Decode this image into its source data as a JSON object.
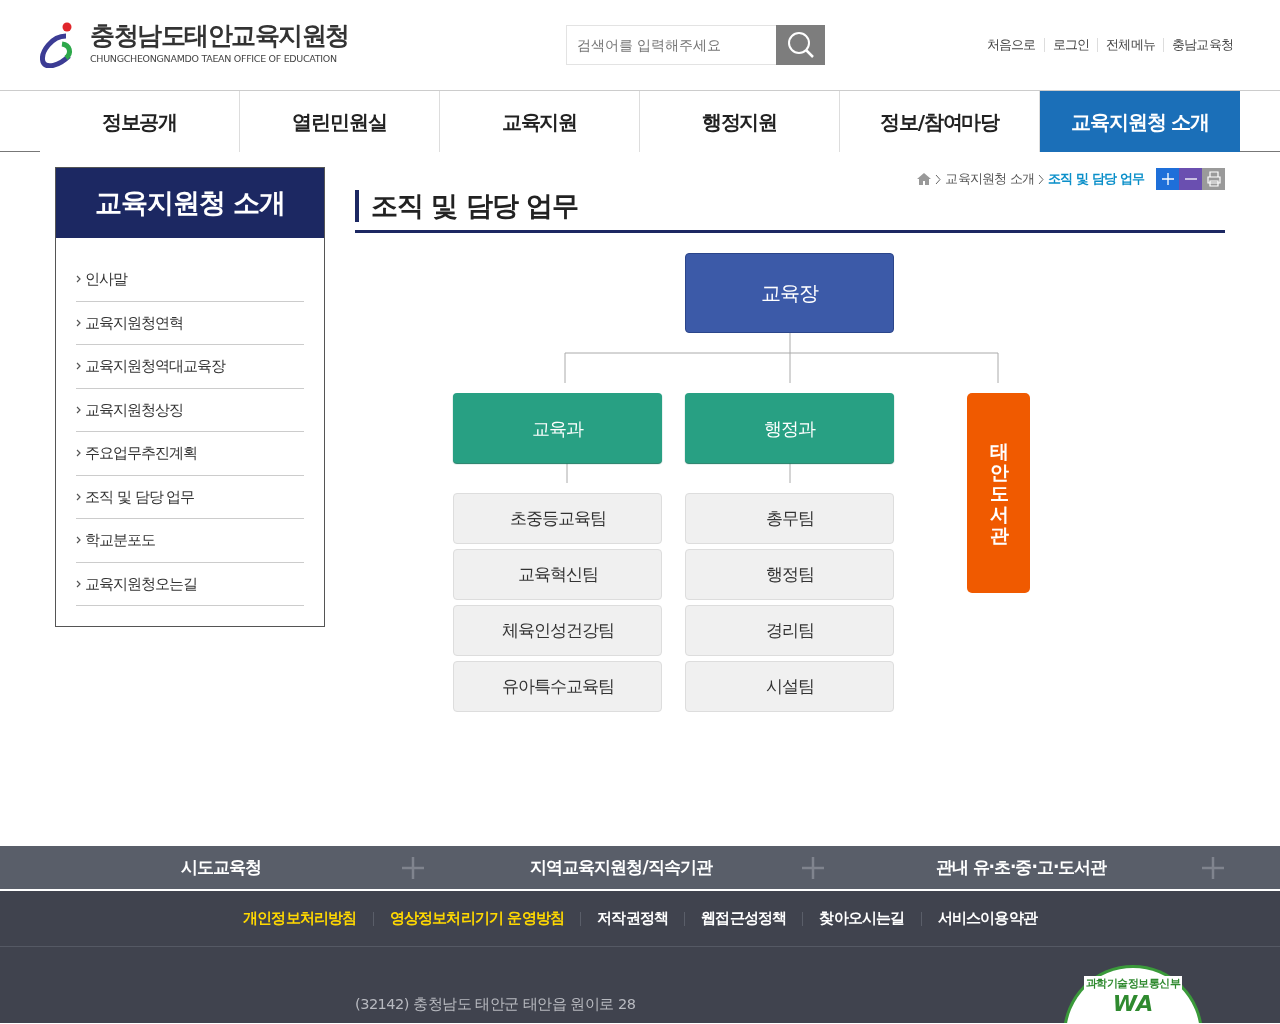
{
  "header": {
    "logo_title": "충청남도태안교육지원청",
    "logo_subtitle": "CHUNGCHEONGNAMDO TAEAN OFFICE OF EDUCATION",
    "search": {
      "placeholder": "검색어를 입력해주세요"
    },
    "util_links": [
      "처음으로",
      "로그인",
      "전체메뉴",
      "충남교육청"
    ]
  },
  "nav": [
    {
      "label": "정보공개",
      "selected": false
    },
    {
      "label": "열린민원실",
      "selected": false
    },
    {
      "label": "교육지원",
      "selected": false
    },
    {
      "label": "행정지원",
      "selected": false
    },
    {
      "label": "정보/참여마당",
      "selected": false
    },
    {
      "label": "교육지원청 소개",
      "selected": true
    }
  ],
  "sidebar": {
    "title": "교육지원청 소개",
    "items": [
      "인사말",
      "교육지원청연혁",
      "교육지원청역대교육장",
      "교육지원청상징",
      "주요업무추진계획",
      "조직 및 담당 업무",
      "학교분포도",
      "교육지원청오는길"
    ]
  },
  "breadcrumb": [
    {
      "label": "교육지원청 소개",
      "current": false
    },
    {
      "label": "조직 및 담당 업무",
      "current": true
    }
  ],
  "page_title": "조직 및 담당 업무",
  "org_chart": {
    "head": "교육장",
    "departments": [
      {
        "label": "교육과",
        "teams": [
          "초중등교육팀",
          "교육혁신팀",
          "체육인성건강팀",
          "유아특수교육팀"
        ]
      },
      {
        "label": "행정과",
        "teams": [
          "총무팀",
          "행정팀",
          "경리팀",
          "시설팀"
        ]
      }
    ],
    "affiliated": "태안도서관"
  },
  "footer": {
    "sites": [
      "시도교육청",
      "지역교육지원청/직속기관",
      "관내 유·초·중·고·도서관"
    ],
    "policy_links": [
      {
        "label": "개인정보처리방침",
        "highlighted": true
      },
      {
        "label": "영상정보처리기기 운영방침",
        "highlighted": true
      },
      {
        "label": "저작권정책",
        "highlighted": false
      },
      {
        "label": "웹접근성정책",
        "highlighted": false
      },
      {
        "label": "찾아오시는길",
        "highlighted": false
      },
      {
        "label": "서비스이용약관",
        "highlighted": false
      }
    ],
    "address": "(32142) 충청남도 태안군 태안읍 원이로 28",
    "cert_mark": {
      "ministry": "과학기술정보통신부",
      "logo": "WA"
    }
  }
}
